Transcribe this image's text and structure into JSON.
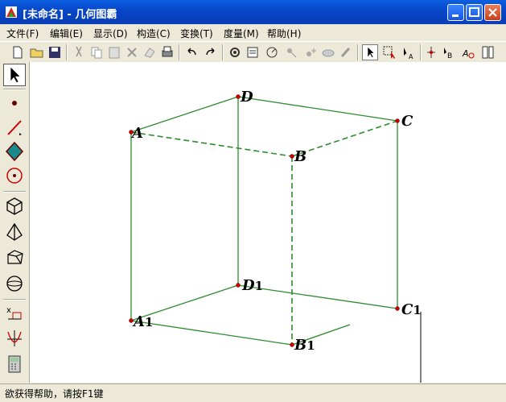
{
  "window": {
    "title": "[未命名] - 几何图霸"
  },
  "menu": [
    "文件(F)",
    "编辑(E)",
    "显示(D)",
    "构造(C)",
    "变换(T)",
    "度量(M)",
    "帮助(H)"
  ],
  "status": {
    "text": "欲获得帮助，请按F1键"
  },
  "points": {
    "A": "A",
    "B": "B",
    "C": "C",
    "D": "D",
    "A1": "A",
    "B1": "B",
    "C1": "C",
    "D1": "D",
    "sub": "1"
  },
  "colors": {
    "edge": "#2e8b2e",
    "point": "#cc0000",
    "titlebar": "#0a5fe0"
  }
}
